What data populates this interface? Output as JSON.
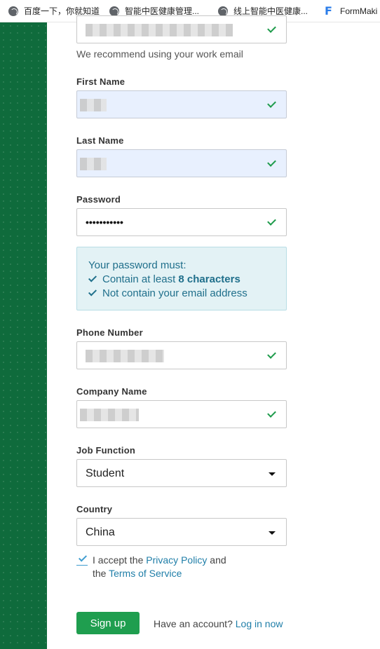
{
  "bookmarks": [
    {
      "label": "百度一下，你就知道",
      "icon": "globe-icon"
    },
    {
      "label": "智能中医健康管理...",
      "icon": "globe-icon"
    },
    {
      "label": "线上智能中医健康...",
      "icon": "globe-icon"
    },
    {
      "label": "FormMaki",
      "icon": "formmaker-logo-icon"
    }
  ],
  "email": {
    "hint": "We recommend using your work email"
  },
  "first_name": {
    "label": "First Name"
  },
  "last_name": {
    "label": "Last Name"
  },
  "password": {
    "label": "Password",
    "masked_value": "•••••••••••"
  },
  "password_rules": {
    "heading": "Your password must:",
    "rule1_prefix": "Contain at least ",
    "rule1_bold": "8 characters",
    "rule2": "Not contain your email address"
  },
  "phone": {
    "label": "Phone Number"
  },
  "company": {
    "label": "Company Name"
  },
  "job_function": {
    "label": "Job Function",
    "value": "Student"
  },
  "country": {
    "label": "Country",
    "value": "China"
  },
  "terms": {
    "prefix": "I accept the ",
    "privacy_link": "Privacy Policy",
    "and": " and",
    "the": "the ",
    "tos_link": "Terms of Service",
    "checked": true
  },
  "actions": {
    "signup_label": "Sign up",
    "have_account": "Have an account? ",
    "login_link": "Log in now"
  },
  "colors": {
    "brand_green": "#1f9e4f",
    "panel_green": "#0f6b3c",
    "link_blue": "#1f7ea8",
    "check_green": "#1e9b4b"
  }
}
